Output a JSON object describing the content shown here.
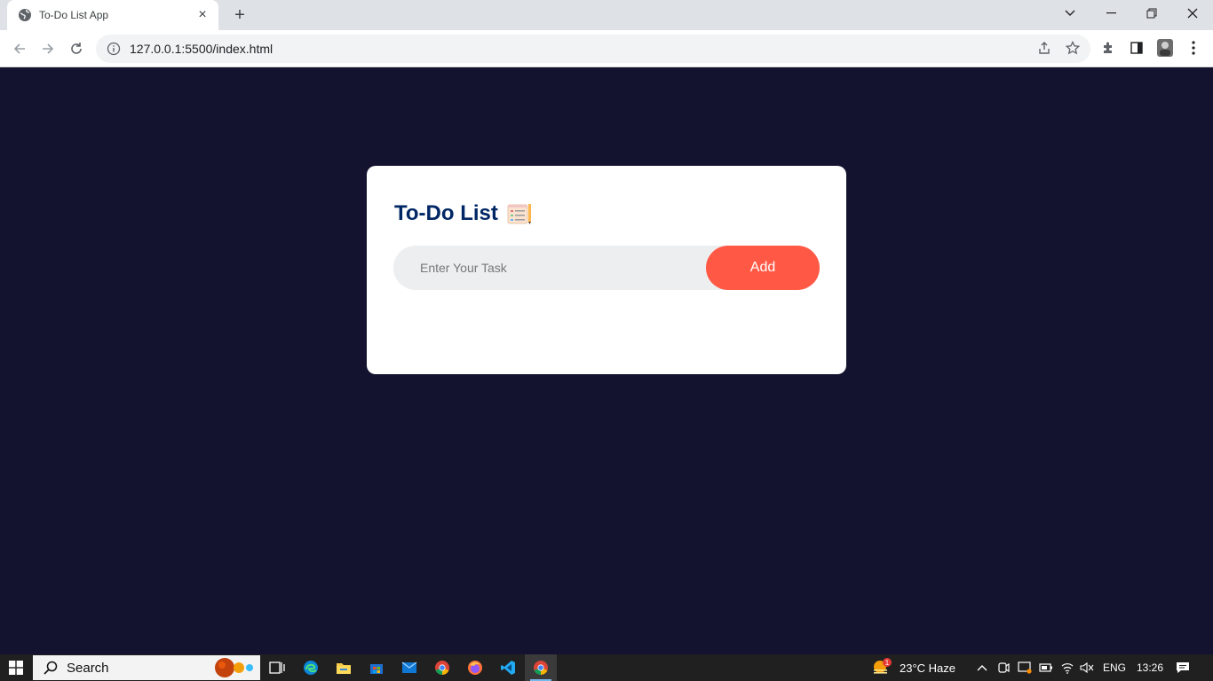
{
  "browser": {
    "tab_title": "To-Do List App",
    "url": "127.0.0.1:5500/index.html"
  },
  "app": {
    "title": "To-Do List",
    "title_icon": "notepad-checklist-icon",
    "input_placeholder": "Enter Your Task",
    "add_label": "Add",
    "colors": {
      "page_bg": "#13132f",
      "card_bg": "#ffffff",
      "title": "#002765",
      "button": "#ff5945",
      "input_bg": "#edeef0"
    }
  },
  "taskbar": {
    "search_label": "Search",
    "weather": "23°C  Haze",
    "weather_badge": "1",
    "language": "ENG",
    "time": "13:26"
  }
}
